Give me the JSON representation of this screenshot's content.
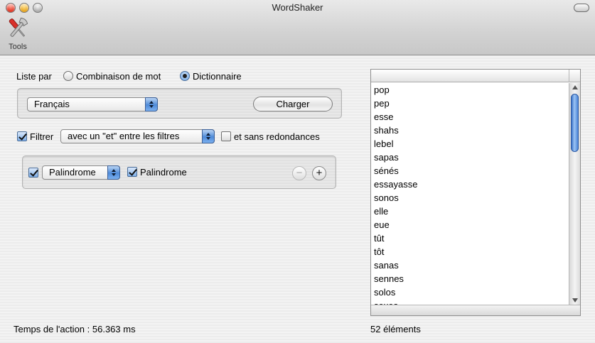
{
  "window": {
    "title": "WordShaker"
  },
  "toolbar": {
    "tools_label": "Tools"
  },
  "list_by": {
    "label": "Liste par",
    "option_word_combination": "Combinaison de mot",
    "option_dictionary": "Dictionnaire",
    "selected": "Dictionnaire"
  },
  "dictionary": {
    "language_selected": "Français",
    "load_button": "Charger"
  },
  "filter": {
    "enabled": true,
    "label": "Filtrer",
    "mode_selected": "avec un \"et\" entre les filtres",
    "no_duplicates_enabled": false,
    "no_duplicates_label": "et sans redondances"
  },
  "filter_rules": [
    {
      "enabled": true,
      "type_selected": "Palindrome",
      "value_checked": true,
      "value_label": "Palindrome"
    }
  ],
  "rule_buttons": {
    "remove": "−",
    "add": "+"
  },
  "results": {
    "items": [
      "pop",
      "pep",
      "esse",
      "shahs",
      "lebel",
      "sapas",
      "sénés",
      "essayasse",
      "sonos",
      "elle",
      "eue",
      "tût",
      "tôt",
      "sanas",
      "sennes",
      "solos",
      "sexes"
    ],
    "count_text": "52 éléments"
  },
  "status": {
    "action_time": "Temps de l'action : 56.363 ms"
  }
}
